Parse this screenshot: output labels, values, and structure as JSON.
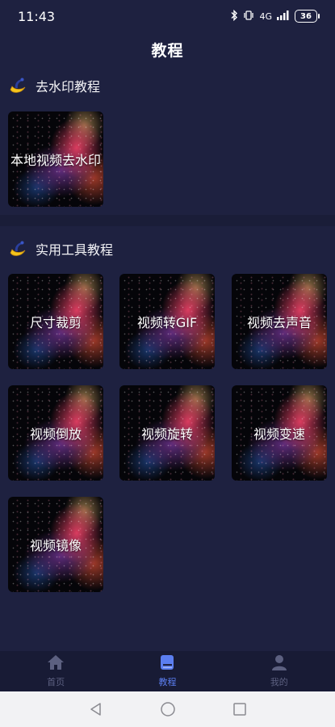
{
  "status_bar": {
    "time": "11:43",
    "network": "4G",
    "battery": "36"
  },
  "header": {
    "title": "教程"
  },
  "sections": [
    {
      "title": "去水印教程",
      "icon": "banana-icon",
      "items": [
        {
          "label": "本地视频去水印"
        }
      ]
    },
    {
      "title": "实用工具教程",
      "icon": "banana-icon",
      "items": [
        {
          "label": "尺寸裁剪"
        },
        {
          "label": "视频转GIF"
        },
        {
          "label": "视频去声音"
        },
        {
          "label": "视频倒放"
        },
        {
          "label": "视频旋转"
        },
        {
          "label": "视频变速"
        },
        {
          "label": "视频镜像"
        }
      ]
    }
  ],
  "bottom_nav": {
    "items": [
      {
        "label": "首页",
        "icon": "home-icon",
        "active": false
      },
      {
        "label": "教程",
        "icon": "book-icon",
        "active": true
      },
      {
        "label": "我的",
        "icon": "user-icon",
        "active": false
      }
    ]
  },
  "colors": {
    "background": "#1e2140",
    "active_tab": "#5b7ef0",
    "inactive_tab": "#5c6080"
  }
}
